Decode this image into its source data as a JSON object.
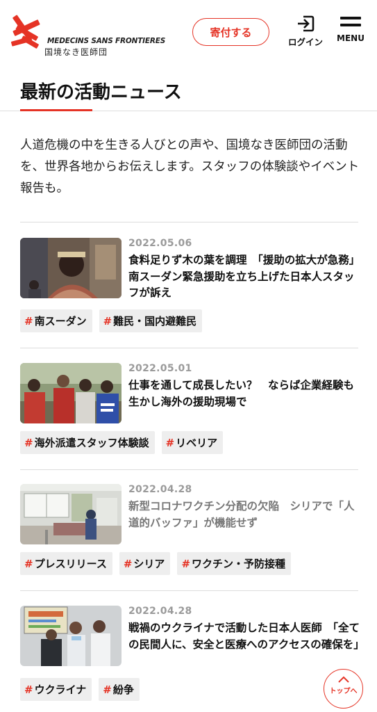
{
  "header": {
    "logo_en": "MEDECINS SANS FRONTIERES",
    "logo_ja": "国境なき医師団",
    "donate_label": "寄付する",
    "login_label": "ログイン",
    "menu_label": "MENU"
  },
  "page": {
    "title": "最新の活動ニュース",
    "intro": "人道危機の中を生きる人びとの声や、国境なき医師団の活動を、世界各地からお伝えします。スタッフの体験談やイベント報告も。"
  },
  "articles": [
    {
      "date": "2022.05.06",
      "title": "食料足りず木の葉を調理　「援助の拡大が急務」南スーダン緊急援助を立ち上げた日本人スタッフが訴え",
      "tags": [
        "南スーダン",
        "難民・国内避難民"
      ]
    },
    {
      "date": "2022.05.01",
      "title": "仕事を通して成長したい？　ならば企業経験も生かし海外の援助現場で",
      "tags": [
        "海外派遣スタッフ体験談",
        "リベリア"
      ]
    },
    {
      "date": "2022.04.28",
      "title": "新型コロナワクチン分配の欠陥　シリアで「人道的バッファ」が機能せず",
      "tags": [
        "プレスリリース",
        "シリア",
        "ワクチン・予防接種"
      ]
    },
    {
      "date": "2022.04.28",
      "title": "戦禍のウクライナで活動した日本人医師　「全ての民間人に、安全と医療へのアクセスの確保を」",
      "tags": [
        "ウクライナ",
        "紛争"
      ]
    }
  ],
  "tag_prefix": "#",
  "scroll_top_label": "トップへ",
  "colors": {
    "accent": "#e53325",
    "date": "#9a9a9a",
    "tag_bg": "#eeeeee"
  },
  "icons": [
    "msf-logo",
    "login-icon",
    "menu-icon",
    "chevron-up-icon"
  ]
}
